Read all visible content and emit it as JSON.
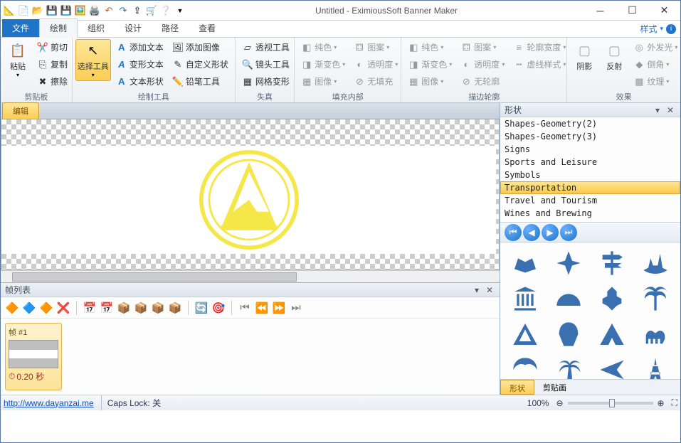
{
  "title": "Untitled - EximiousSoft Banner Maker",
  "tabs": {
    "file": "文件",
    "draw": "绘制",
    "org": "组织",
    "design": "设计",
    "path": "路径",
    "view": "查看",
    "style": "样式"
  },
  "ribbon": {
    "clipboard": {
      "paste": "粘贴",
      "cut": "剪切",
      "copy": "复制",
      "erase": "擦除",
      "label": "剪贴板"
    },
    "tools": {
      "select": "选择工具",
      "addtext": "添加文本",
      "addimage": "添加图像",
      "transformtext": "变形文本",
      "customshape": "自定义形状",
      "textshape": "文本形状",
      "pencil": "铅笔工具",
      "label": "绘制工具"
    },
    "distort": {
      "perspective": "透视工具",
      "lens": "镜头工具",
      "mesh": "网格变形",
      "label": "失真"
    },
    "fillin": {
      "solid": "纯色",
      "image": "图案",
      "gradient": "渐变色",
      "opacity": "透明度",
      "generic": "图像",
      "nofill": "无填充",
      "label": "填充内部"
    },
    "outline": {
      "solid": "纯色",
      "image": "图案",
      "gradient": "渐变色",
      "opacity": "透明度",
      "generic": "图像",
      "none": "无轮廓",
      "width": "轮廓宽度",
      "dash": "虚线样式",
      "label": "描边轮廓"
    },
    "effects": {
      "shadow": "阴影",
      "reflect": "反射",
      "outglow": "外发光",
      "bevel": "倒角",
      "texture": "纹理",
      "label": "效果"
    }
  },
  "canvasTab": {
    "edit": "编辑"
  },
  "framePanel": {
    "title": "帧列表",
    "frame": "帧 #1",
    "time": "0.20 秒"
  },
  "shapePanel": {
    "title": "形状",
    "categories": [
      "Shapes-Geometry(2)",
      "Shapes-Geometry(3)",
      "Signs",
      "Sports and Leisure",
      "Symbols",
      "Transportation",
      "Travel and Tourism",
      "Wines and Brewing"
    ],
    "selected": "Transportation",
    "tabs": {
      "shapes": "形状",
      "clipart": "剪贴画"
    }
  },
  "status": {
    "url": "http://www.dayanzai.me",
    "caps": "Caps Lock: 关",
    "zoom": "100%"
  }
}
